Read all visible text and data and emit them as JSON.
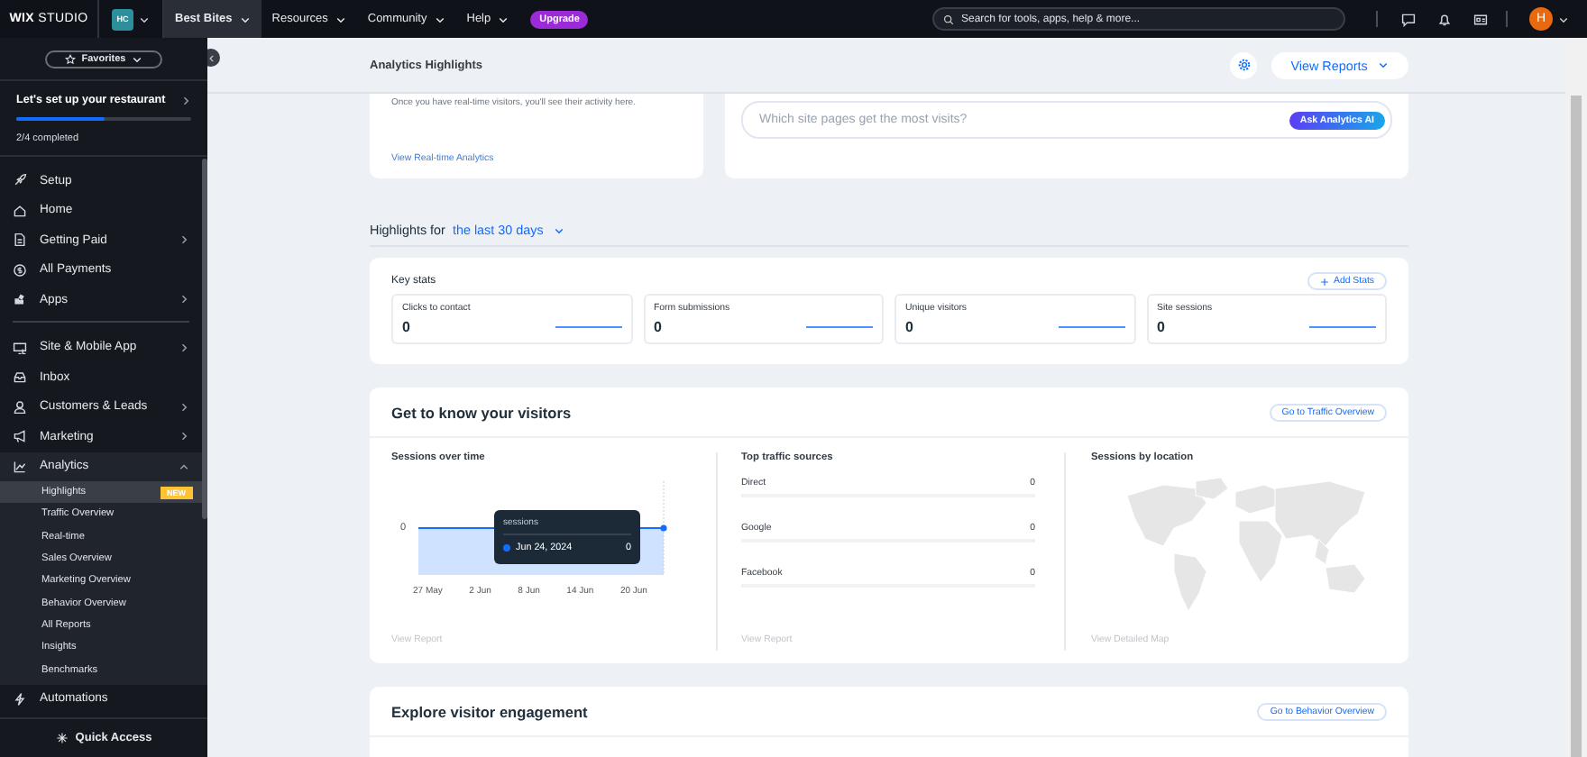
{
  "topbar": {
    "logo": "**WIX** STUDIO",
    "site_badge": "HC",
    "nav": [
      {
        "label": "Best Bites",
        "selected": true
      },
      {
        "label": "Resources",
        "selected": false
      },
      {
        "label": "Community",
        "selected": false
      },
      {
        "label": "Help",
        "selected": false
      }
    ],
    "upgrade": "Upgrade",
    "search": {
      "placeholder": "Search for tools, apps, help & more..."
    },
    "avatar": "H"
  },
  "sidebar": {
    "favorites": "Favorites",
    "setup": {
      "title": "Let's set up your restaurant",
      "level": 0.5,
      "progress": "2/4 completed"
    },
    "groups": [
      {
        "items": [
          {
            "label": "Setup",
            "expandable": false,
            "expanded": false
          },
          {
            "label": "Home",
            "expandable": false,
            "expanded": false
          },
          {
            "label": "Getting Paid",
            "expandable": true,
            "expanded": false
          },
          {
            "label": "All Payments",
            "expandable": false,
            "expanded": false
          },
          {
            "label": "Apps",
            "expandable": true,
            "expanded": false
          }
        ]
      },
      {
        "items": [
          {
            "label": "Site & Mobile App",
            "expandable": true,
            "expanded": false
          },
          {
            "label": "Inbox",
            "expandable": false,
            "expanded": false
          },
          {
            "label": "Customers & Leads",
            "expandable": true,
            "expanded": false
          },
          {
            "label": "Marketing",
            "expandable": true,
            "expanded": false
          },
          {
            "label": "Analytics",
            "expandable": true,
            "expanded": true,
            "children": [
              {
                "label": "Highlights",
                "selected": true,
                "badge": "NEW"
              },
              {
                "label": "Traffic Overview",
                "selected": false
              },
              {
                "label": "Real-time",
                "selected": false
              },
              {
                "label": "Sales Overview",
                "selected": false
              },
              {
                "label": "Marketing Overview",
                "selected": false
              },
              {
                "label": "Behavior Overview",
                "selected": false
              },
              {
                "label": "All Reports",
                "selected": false
              },
              {
                "label": "Insights",
                "selected": false
              },
              {
                "label": "Benchmarks",
                "selected": false
              }
            ]
          },
          {
            "label": "Automations",
            "expandable": false,
            "expanded": false
          }
        ]
      }
    ],
    "quick_access": "Quick Access"
  },
  "header": {
    "title": "Analytics Highlights",
    "button": "View Reports"
  },
  "realtime_card": {
    "text": "Once you have real-time visitors, you'll see their activity here.",
    "link": "View Real-time Analytics"
  },
  "ai_card": {
    "placeholder": "Which site pages get the most visits?",
    "button": "Ask Analytics AI"
  },
  "period": {
    "label": "Highlights for",
    "value": "the last 30 days"
  },
  "key_stats": {
    "title": "Key stats",
    "button": "Add Stats",
    "stats": [
      {
        "label": "Clicks to contact",
        "value": "0"
      },
      {
        "label": "Form submissions",
        "value": "0"
      },
      {
        "label": "Unique visitors",
        "value": "0"
      },
      {
        "label": "Site sessions",
        "value": "0"
      }
    ]
  },
  "visitors": {
    "title": "Get to know your visitors",
    "button": "Go to Traffic Overview",
    "sessions": {
      "title": "Sessions over time",
      "y_label": "0",
      "x_labels": [
        "27 May",
        "2 Jun",
        "8 Jun",
        "14 Jun",
        "20 Jun"
      ],
      "tooltip": {
        "title": "sessions",
        "date": "Jun 24, 2024",
        "value": "0"
      },
      "link": "View Report"
    },
    "sources": {
      "title": "Top traffic sources",
      "rows": [
        {
          "label": "Direct",
          "value": "0",
          "level": 0
        },
        {
          "label": "Google",
          "value": "0",
          "level": 0
        },
        {
          "label": "Facebook",
          "value": "0",
          "level": 0
        }
      ],
      "link": "View Report"
    },
    "location": {
      "title": "Sessions by location",
      "link": "View Detailed Map"
    }
  },
  "engagement": {
    "title": "Explore visitor engagement",
    "button": "Go to Behavior Overview"
  }
}
